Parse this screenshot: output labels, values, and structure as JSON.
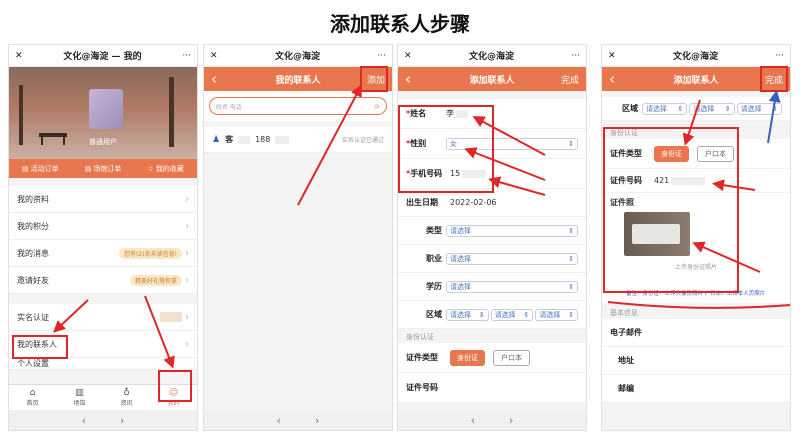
{
  "title": "添加联系人步骤",
  "nav": {
    "back": "‹",
    "forward": "›"
  },
  "p1": {
    "close": "✕",
    "app_title": "文化@海淀 — 我的",
    "more": "···",
    "username": "普通用户",
    "tabs": [
      "活动订单",
      "场馆订单",
      "我的收藏"
    ],
    "menu": [
      "我的资料",
      "我的积分",
      "我的消息",
      "邀请好友"
    ],
    "msg_badge": "您有(2)条未读信息!",
    "invite_badge": "精美好礼等你拿",
    "realname": "实名认证",
    "contacts": "我的联系人",
    "extra": "个人设置",
    "bottom_tabs": [
      "首页",
      "场馆",
      "资讯",
      "我的"
    ]
  },
  "p2": {
    "close": "✕",
    "app_title": "文化@海淀",
    "more": "···",
    "header": "我的联系人",
    "add": "添加",
    "search_placeholder": "姓名 电话",
    "contact_name": "客",
    "contact_phone": "188",
    "contact_status": "实名认证已通过"
  },
  "p3": {
    "close": "✕",
    "app_title": "文化@海淀",
    "more": "···",
    "header": "添加联系人",
    "done": "完成",
    "name_label": "姓名",
    "name_value": "李",
    "gender_label": "性别",
    "gender_value": "女",
    "phone_label": "手机号码",
    "phone_value": "15",
    "birth_label": "出生日期",
    "birth_value": "2022-02-06",
    "type_label": "类型",
    "job_label": "职业",
    "edu_label": "学历",
    "area_label": "区域",
    "please_select": "请选择",
    "id_section": "身份认证",
    "id_type_label": "证件类型",
    "id_card": "身份证",
    "hukou": "户口本",
    "id_no_label": "证件号码"
  },
  "p4": {
    "close": "✕",
    "app_title": "文化@海淀",
    "more": "···",
    "header": "添加联系人",
    "done": "完成",
    "area_label": "区域",
    "please_select": "请选择",
    "id_section": "身份认证",
    "id_type_label": "证件类型",
    "id_card": "身份证",
    "hukou": "户口本",
    "id_no_label": "证件号码",
    "id_no_value": "421",
    "photo_label": "证件照",
    "upload_caption": "上传身份证照片",
    "note": "备注：身份证：上传头像页照片 户口本：上传本人页照片",
    "basic_section": "基本信息",
    "email_label": "电子邮件",
    "address_label": "地址",
    "post_label": "邮编"
  },
  "colors": {
    "accent": "#e8774d",
    "annot": "#e02626",
    "link": "#3560c0"
  }
}
